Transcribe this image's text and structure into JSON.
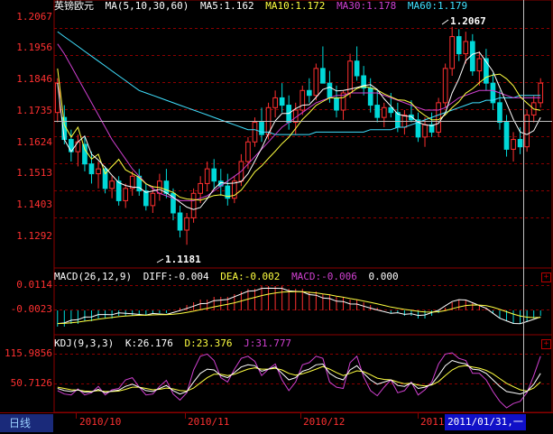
{
  "main": {
    "symbol": "英镑欧元",
    "ma_params": "MA(5,10,30,60)",
    "ma5": "MA5:1.162",
    "ma10": "MA10:1.172",
    "ma30": "MA30:1.178",
    "ma60": "MA60:1.179",
    "y_ticks": [
      "1.2067",
      "1.1956",
      "1.1846",
      "1.1735",
      "1.1624",
      "1.1513",
      "1.1403",
      "1.1292"
    ],
    "high_label": "1.2067",
    "low_label": "1.1181"
  },
  "macd": {
    "params": "MACD(26,12,9)",
    "diff": "DIFF:-0.004",
    "dea": "DEA:-0.002",
    "macd": "MACD:-0.006",
    "extra": "0.000",
    "y_ticks": [
      "0.0114",
      "-0.0023"
    ]
  },
  "kdj": {
    "params": "KDJ(9,3,3)",
    "k": "K:26.176",
    "d": "D:23.376",
    "j": "J:31.777",
    "y_ticks": [
      "115.9856",
      "50.7126"
    ]
  },
  "bottom": {
    "tab_label": "日线",
    "x_labels": [
      "2010/10",
      "2010/11",
      "2010/12",
      "2011"
    ],
    "cursor_date": "2011/01/31,一"
  },
  "colors": {
    "bg": "#000000",
    "grid": "#8b0000",
    "up": "#ff3030",
    "down": "#00d8d8",
    "ma5": "#ffffff",
    "ma10": "#ffff40",
    "ma30": "#d040d0",
    "ma60": "#40e0ff"
  },
  "chart_data": {
    "type": "line",
    "title": "英镑欧元",
    "ylim": [
      1.11,
      1.215
    ],
    "x_labels": [
      "2010/10",
      "2010/11",
      "2010/12",
      "2011"
    ],
    "candles": [
      [
        1.172,
        1.186,
        1.168,
        1.184
      ],
      [
        1.17,
        1.175,
        1.159,
        1.161
      ],
      [
        1.161,
        1.165,
        1.152,
        1.156
      ],
      [
        1.156,
        1.163,
        1.15,
        1.16
      ],
      [
        1.159,
        1.162,
        1.148,
        1.151
      ],
      [
        1.151,
        1.156,
        1.143,
        1.147
      ],
      [
        1.147,
        1.152,
        1.141,
        1.149
      ],
      [
        1.149,
        1.15,
        1.139,
        1.141
      ],
      [
        1.141,
        1.146,
        1.137,
        1.144
      ],
      [
        1.144,
        1.146,
        1.134,
        1.136
      ],
      [
        1.136,
        1.143,
        1.133,
        1.141
      ],
      [
        1.141,
        1.148,
        1.138,
        1.146
      ],
      [
        1.146,
        1.149,
        1.138,
        1.14
      ],
      [
        1.14,
        1.143,
        1.132,
        1.134
      ],
      [
        1.134,
        1.142,
        1.131,
        1.139
      ],
      [
        1.139,
        1.147,
        1.136,
        1.144
      ],
      [
        1.144,
        1.149,
        1.137,
        1.139
      ],
      [
        1.139,
        1.141,
        1.128,
        1.131
      ],
      [
        1.131,
        1.134,
        1.121,
        1.124
      ],
      [
        1.124,
        1.131,
        1.118,
        1.129
      ],
      [
        1.129,
        1.141,
        1.127,
        1.139
      ],
      [
        1.139,
        1.146,
        1.135,
        1.143
      ],
      [
        1.143,
        1.152,
        1.14,
        1.149
      ],
      [
        1.149,
        1.153,
        1.141,
        1.144
      ],
      [
        1.144,
        1.149,
        1.138,
        1.142
      ],
      [
        1.142,
        1.147,
        1.134,
        1.137
      ],
      [
        1.137,
        1.146,
        1.135,
        1.144
      ],
      [
        1.144,
        1.155,
        1.142,
        1.152
      ],
      [
        1.152,
        1.162,
        1.149,
        1.16
      ],
      [
        1.16,
        1.17,
        1.158,
        1.168
      ],
      [
        1.168,
        1.174,
        1.16,
        1.163
      ],
      [
        1.163,
        1.176,
        1.161,
        1.174
      ],
      [
        1.174,
        1.181,
        1.17,
        1.178
      ],
      [
        1.178,
        1.184,
        1.172,
        1.175
      ],
      [
        1.175,
        1.179,
        1.165,
        1.168
      ],
      [
        1.168,
        1.176,
        1.163,
        1.173
      ],
      [
        1.173,
        1.183,
        1.171,
        1.181
      ],
      [
        1.181,
        1.186,
        1.176,
        1.179
      ],
      [
        1.179,
        1.192,
        1.177,
        1.19
      ],
      [
        1.19,
        1.199,
        1.186,
        1.184
      ],
      [
        1.184,
        1.189,
        1.176,
        1.178
      ],
      [
        1.178,
        1.183,
        1.17,
        1.173
      ],
      [
        1.173,
        1.181,
        1.169,
        1.18
      ],
      [
        1.18,
        1.196,
        1.178,
        1.193
      ],
      [
        1.193,
        1.199,
        1.185,
        1.187
      ],
      [
        1.187,
        1.191,
        1.179,
        1.182
      ],
      [
        1.182,
        1.186,
        1.172,
        1.175
      ],
      [
        1.175,
        1.181,
        1.168,
        1.17
      ],
      [
        1.17,
        1.176,
        1.166,
        1.174
      ],
      [
        1.174,
        1.18,
        1.17,
        1.172
      ],
      [
        1.172,
        1.176,
        1.164,
        1.166
      ],
      [
        1.166,
        1.173,
        1.163,
        1.171
      ],
      [
        1.171,
        1.177,
        1.168,
        1.169
      ],
      [
        1.169,
        1.172,
        1.16,
        1.162
      ],
      [
        1.162,
        1.17,
        1.158,
        1.167
      ],
      [
        1.167,
        1.172,
        1.162,
        1.164
      ],
      [
        1.164,
        1.178,
        1.162,
        1.176
      ],
      [
        1.176,
        1.192,
        1.174,
        1.19
      ],
      [
        1.19,
        1.207,
        1.187,
        1.203
      ],
      [
        1.203,
        1.206,
        1.193,
        1.196
      ],
      [
        1.196,
        1.205,
        1.192,
        1.201
      ],
      [
        1.201,
        1.204,
        1.187,
        1.189
      ],
      [
        1.189,
        1.197,
        1.183,
        1.194
      ],
      [
        1.194,
        1.198,
        1.181,
        1.184
      ],
      [
        1.184,
        1.188,
        1.173,
        1.176
      ],
      [
        1.176,
        1.181,
        1.165,
        1.168
      ],
      [
        1.168,
        1.171,
        1.154,
        1.157
      ],
      [
        1.157,
        1.164,
        1.152,
        1.161
      ],
      [
        1.161,
        1.166,
        1.155,
        1.158
      ],
      [
        1.158,
        1.173,
        1.156,
        1.171
      ],
      [
        1.171,
        1.179,
        1.168,
        1.176
      ],
      [
        1.176,
        1.186,
        1.174,
        1.184
      ]
    ],
    "ma60": [
      1.205,
      1.203,
      1.201,
      1.199,
      1.197,
      1.195,
      1.193,
      1.191,
      1.189,
      1.187,
      1.185,
      1.183,
      1.181,
      1.18,
      1.179,
      1.178,
      1.177,
      1.176,
      1.175,
      1.174,
      1.173,
      1.172,
      1.171,
      1.17,
      1.169,
      1.168,
      1.167,
      1.166,
      1.165,
      1.165,
      1.164,
      1.164,
      1.163,
      1.163,
      1.163,
      1.163,
      1.163,
      1.163,
      1.164,
      1.164,
      1.164,
      1.164,
      1.164,
      1.164,
      1.164,
      1.164,
      1.165,
      1.165,
      1.165,
      1.165,
      1.166,
      1.166,
      1.167,
      1.168,
      1.169,
      1.17,
      1.171,
      1.172,
      1.173,
      1.174,
      1.175,
      1.176,
      1.176,
      1.177,
      1.177,
      1.178,
      1.178,
      1.178,
      1.179,
      1.179,
      1.179,
      1.179
    ],
    "ma30": [
      1.2,
      1.196,
      1.191,
      1.186,
      1.181,
      1.176,
      1.171,
      1.166,
      1.161,
      1.157,
      1.153,
      1.149,
      1.146,
      1.143,
      1.141,
      1.139,
      1.138,
      1.137,
      1.136,
      1.136,
      1.136,
      1.137,
      1.138,
      1.14,
      1.142,
      1.144,
      1.146,
      1.148,
      1.151,
      1.154,
      1.157,
      1.16,
      1.163,
      1.166,
      1.168,
      1.17,
      1.172,
      1.174,
      1.176,
      1.177,
      1.178,
      1.179,
      1.179,
      1.18,
      1.18,
      1.18,
      1.18,
      1.18,
      1.179,
      1.178,
      1.177,
      1.176,
      1.175,
      1.174,
      1.173,
      1.173,
      1.173,
      1.174,
      1.176,
      1.178,
      1.179,
      1.18,
      1.181,
      1.181,
      1.181,
      1.18,
      1.179,
      1.178,
      1.178,
      1.178,
      1.178,
      1.178
    ],
    "macd_hist": [
      -0.006,
      -0.006,
      -0.005,
      -0.005,
      -0.004,
      -0.004,
      -0.003,
      -0.003,
      -0.003,
      -0.002,
      -0.002,
      -0.002,
      -0.002,
      -0.002,
      -0.001,
      -0.001,
      -0.001,
      0.0,
      0.001,
      0.002,
      0.003,
      0.004,
      0.004,
      0.005,
      0.005,
      0.005,
      0.006,
      0.007,
      0.008,
      0.008,
      0.009,
      0.009,
      0.009,
      0.009,
      0.008,
      0.008,
      0.008,
      0.007,
      0.007,
      0.006,
      0.006,
      0.005,
      0.005,
      0.004,
      0.004,
      0.003,
      0.002,
      0.001,
      0.0,
      -0.001,
      -0.001,
      -0.002,
      -0.002,
      -0.003,
      -0.003,
      -0.002,
      -0.001,
      0.001,
      0.003,
      0.004,
      0.004,
      0.003,
      0.002,
      0.001,
      -0.001,
      -0.003,
      -0.004,
      -0.005,
      -0.005,
      -0.004,
      -0.003,
      -0.002
    ],
    "kdj_k": [
      35,
      30,
      28,
      32,
      26,
      27,
      33,
      25,
      29,
      31,
      40,
      45,
      38,
      30,
      28,
      35,
      42,
      30,
      22,
      28,
      50,
      70,
      80,
      78,
      65,
      60,
      72,
      85,
      90,
      88,
      75,
      80,
      85,
      70,
      55,
      60,
      75,
      80,
      90,
      92,
      70,
      60,
      55,
      78,
      88,
      70,
      55,
      45,
      50,
      55,
      42,
      40,
      48,
      35,
      38,
      45,
      65,
      88,
      100,
      95,
      92,
      80,
      78,
      70,
      55,
      40,
      28,
      25,
      22,
      28,
      45,
      70
    ],
    "kdj_d": [
      38,
      35,
      32,
      31,
      29,
      28,
      30,
      28,
      28,
      29,
      33,
      38,
      38,
      35,
      32,
      33,
      36,
      34,
      30,
      29,
      36,
      48,
      60,
      68,
      68,
      65,
      68,
      74,
      80,
      83,
      80,
      80,
      82,
      78,
      70,
      66,
      69,
      74,
      80,
      86,
      80,
      72,
      65,
      70,
      76,
      74,
      67,
      59,
      56,
      55,
      50,
      46,
      47,
      43,
      41,
      43,
      51,
      65,
      78,
      86,
      88,
      85,
      82,
      77,
      69,
      58,
      47,
      39,
      32,
      29,
      36,
      50
    ],
    "kdj_j": [
      30,
      22,
      20,
      34,
      20,
      25,
      40,
      20,
      32,
      35,
      55,
      60,
      38,
      20,
      22,
      40,
      54,
      22,
      8,
      25,
      78,
      110,
      115,
      100,
      60,
      50,
      80,
      105,
      110,
      98,
      65,
      80,
      92,
      55,
      30,
      50,
      90,
      95,
      110,
      105,
      50,
      38,
      35,
      95,
      110,
      62,
      30,
      18,
      38,
      55,
      25,
      30,
      50,
      20,
      32,
      50,
      92,
      115,
      118,
      105,
      100,
      70,
      70,
      55,
      28,
      5,
      -10,
      0,
      5,
      25,
      65,
      110
    ]
  }
}
